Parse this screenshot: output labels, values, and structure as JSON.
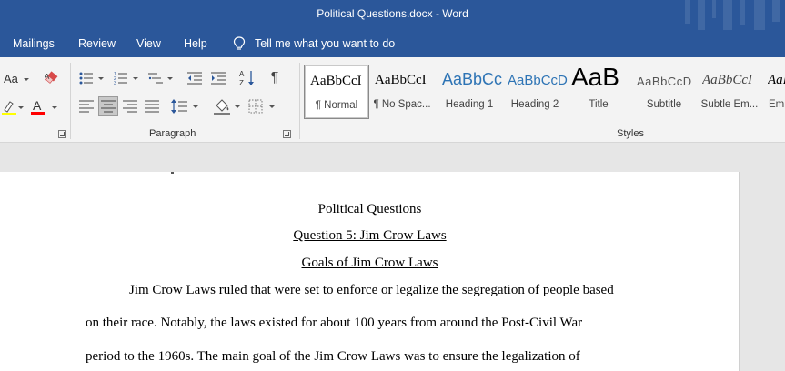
{
  "window": {
    "title": "Political Questions.docx  -  Word"
  },
  "menu": {
    "tabs": [
      {
        "label": "Mailings"
      },
      {
        "label": "Review"
      },
      {
        "label": "View"
      },
      {
        "label": "Help"
      }
    ],
    "tell_me": "Tell me what you want to do",
    "tell_me_icon": "lightbulb-icon"
  },
  "ribbon": {
    "font_group": {
      "change_case": "Aa",
      "clear_formatting_icon": "eraser-icon",
      "highlight_color": "#ffff00",
      "font_color": "#ff0000",
      "font_color_letter": "A"
    },
    "paragraph_group": {
      "label": "Paragraph",
      "pilcrow": "¶",
      "sort_label": "A Z"
    },
    "styles_group": {
      "label": "Styles",
      "items": [
        {
          "sample": "AaBbCcI",
          "name": "¶ Normal",
          "selected": true
        },
        {
          "sample": "AaBbCcI",
          "name": "¶ No Spac..."
        },
        {
          "sample": "AaBbCc",
          "name": "Heading 1"
        },
        {
          "sample": "AaBbCcD",
          "name": "Heading 2"
        },
        {
          "sample": "AaB",
          "name": "Title"
        },
        {
          "sample": "AaBbCcD",
          "name": "Subtitle"
        },
        {
          "sample": "AaBbCcI",
          "name": "Subtle Em..."
        },
        {
          "sample": "AaBbCcI",
          "name": "Em"
        }
      ]
    }
  },
  "document": {
    "title": "Political Questions",
    "question": "Question 5: Jim Crow Laws",
    "heading": "Goals of Jim Crow Laws",
    "lines": [
      "Jim Crow Laws ruled that were set to enforce or legalize the segregation of people based",
      "on their race. Notably, the laws existed for about 100 years from around the Post-Civil War",
      "period to the 1960s. The main goal of the Jim Crow Laws was to ensure the legalization of"
    ]
  },
  "colors": {
    "word_blue": "#2b579a",
    "ribbon_bg": "#f3f3f3",
    "canvas_bg": "#e6e6e6"
  }
}
